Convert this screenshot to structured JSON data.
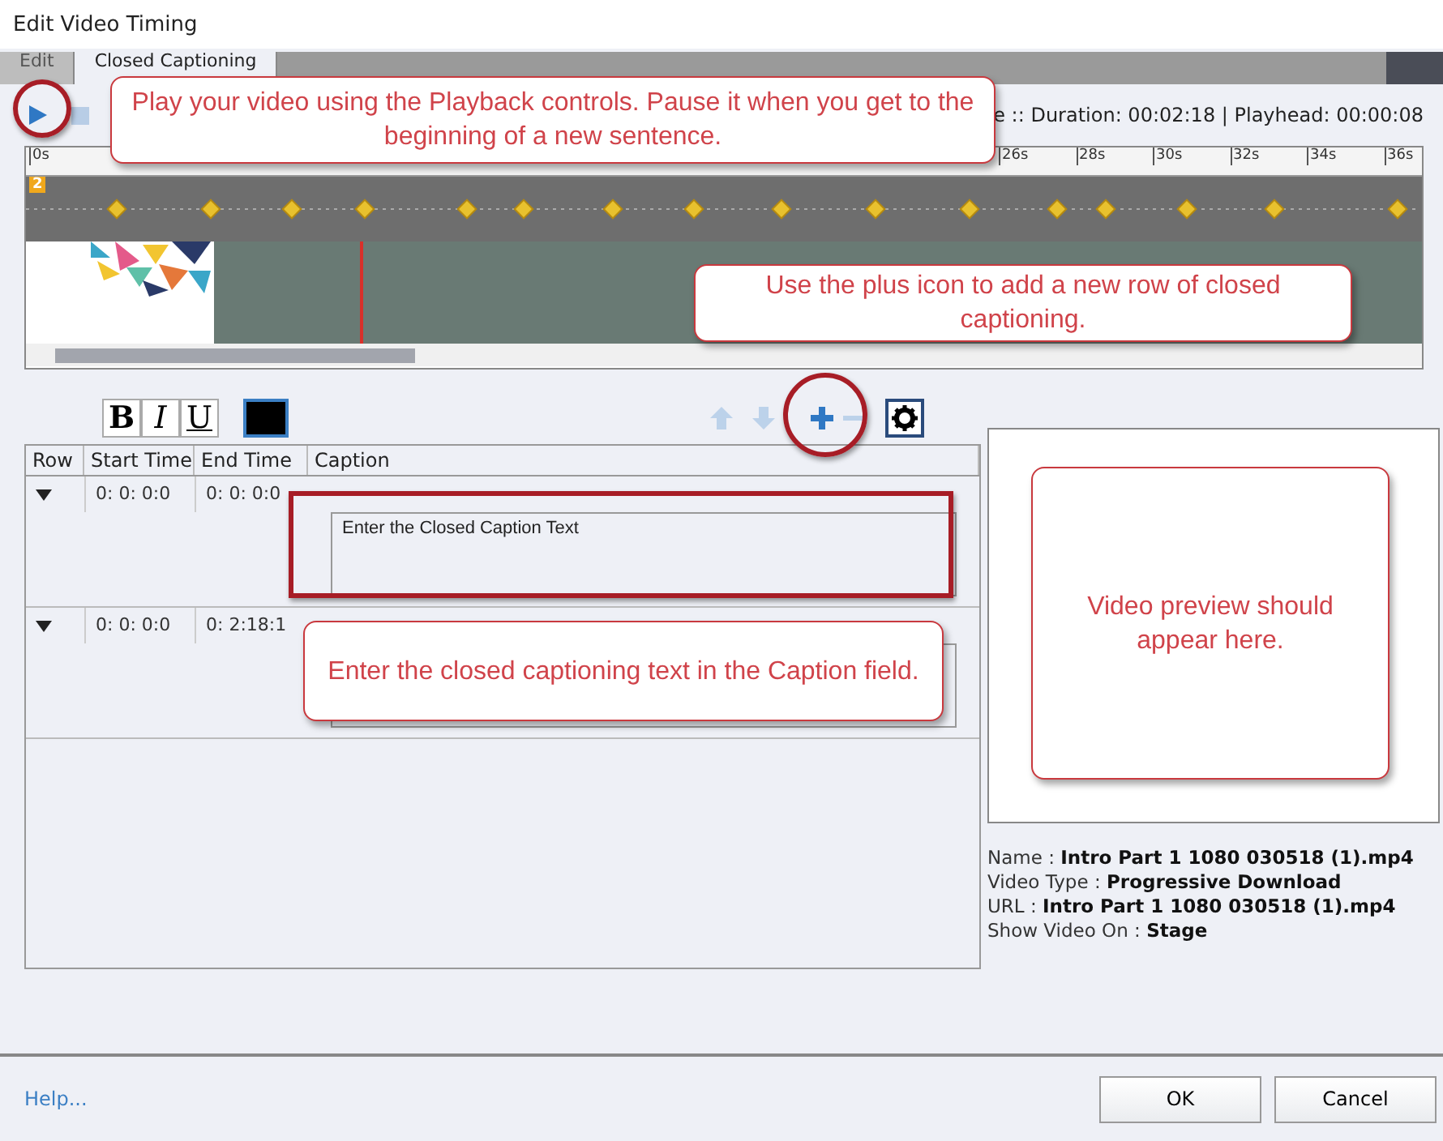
{
  "window": {
    "title": "Edit Video Timing"
  },
  "tabs": [
    {
      "label": "Edit",
      "selected": false
    },
    {
      "label": "Closed Captioning",
      "selected": true
    }
  ],
  "status": "e :: Duration: 00:02:18 | Playhead: 00:00:08",
  "timeline": {
    "ruler_labels": [
      "0s",
      "26s",
      "28s",
      "30s",
      "32s",
      "34s",
      "36s"
    ],
    "track_label": "2"
  },
  "format_toolbar": {
    "bold": "B",
    "italic": "I",
    "underline": "U"
  },
  "table": {
    "columns": [
      "Row",
      "Start Time",
      "End Time",
      "Caption"
    ],
    "rows": [
      {
        "expanded": true,
        "start": "0: 0: 0:0",
        "end": "0: 0: 0:0",
        "caption": "Enter the Closed Caption Text"
      },
      {
        "expanded": true,
        "start": "0: 0: 0:0",
        "end": "0: 2:18:1",
        "caption": ""
      }
    ]
  },
  "info": [
    "Name  : **Intro Part 1 1080 030518 (1).mp4**",
    "Video Type :  **Progressive Download**",
    "URL : **Intro Part 1 1080 030518 (1).mp4**",
    "Show Video On : **Stage**"
  ],
  "callouts": [
    {
      "text": "Play your video using the Playback controls. Pause it when you get to the beginning of a new sentence."
    },
    {
      "text": "Use the plus icon to add a new row of closed captioning."
    },
    {
      "text": "Enter the closed captioning text in the Caption field."
    },
    {
      "text": "Video preview should appear here."
    }
  ],
  "help": "Help...",
  "buttons": [
    "OK",
    "Cancel"
  ]
}
